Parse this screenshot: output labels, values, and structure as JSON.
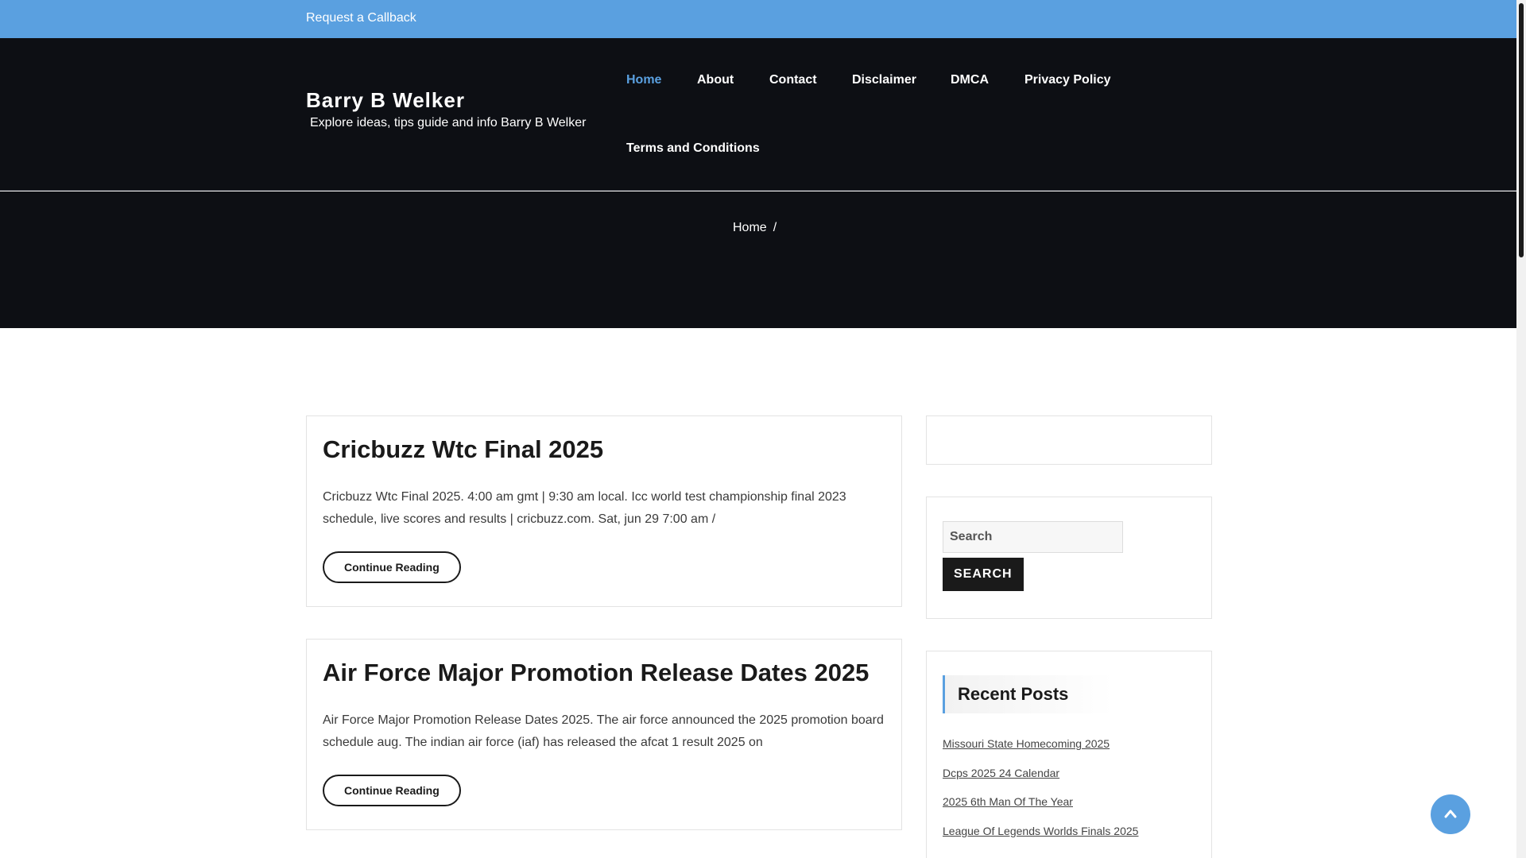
{
  "topbar": {
    "callback_label": "Request a Callback"
  },
  "site": {
    "title": "Barry B Welker",
    "tagline": "Explore ideas, tips guide and info Barry B Welker"
  },
  "nav": {
    "items": [
      {
        "label": "Home"
      },
      {
        "label": "About"
      },
      {
        "label": "Contact"
      },
      {
        "label": "Disclaimer"
      },
      {
        "label": "DMCA"
      },
      {
        "label": "Privacy Policy"
      },
      {
        "label": "Terms and Conditions"
      }
    ]
  },
  "breadcrumb": {
    "home": "Home",
    "separator": "/"
  },
  "posts": [
    {
      "title": "Cricbuzz Wtc Final 2025",
      "excerpt": "Cricbuzz Wtc Final 2025. 4:00 am gmt | 9:30 am local. Icc world test championship final 2023 schedule, live scores and results | cricbuzz.com. Sat, jun 29 7:00 am /",
      "button": "Continue Reading"
    },
    {
      "title": "Air Force Major Promotion Release Dates 2025",
      "excerpt": "Air Force Major Promotion Release Dates 2025. The air force announced the 2025 promotion board schedule aug. The indian air force (iaf) has released the afcat 1 result 2025 on",
      "button": "Continue Reading"
    }
  ],
  "search": {
    "placeholder": "Search",
    "button": "SEARCH"
  },
  "recent_posts": {
    "title": "Recent Posts",
    "items": [
      "Missouri State Homecoming 2025",
      "Dcps 2025 24 Calendar",
      "2025 6th Man Of The Year",
      "League Of Legends Worlds Finals 2025"
    ]
  },
  "colors": {
    "accent": "#5aa0e0",
    "header_bg": "#0d0f14"
  },
  "icons": {
    "scroll_top": "chevron-up-icon"
  }
}
